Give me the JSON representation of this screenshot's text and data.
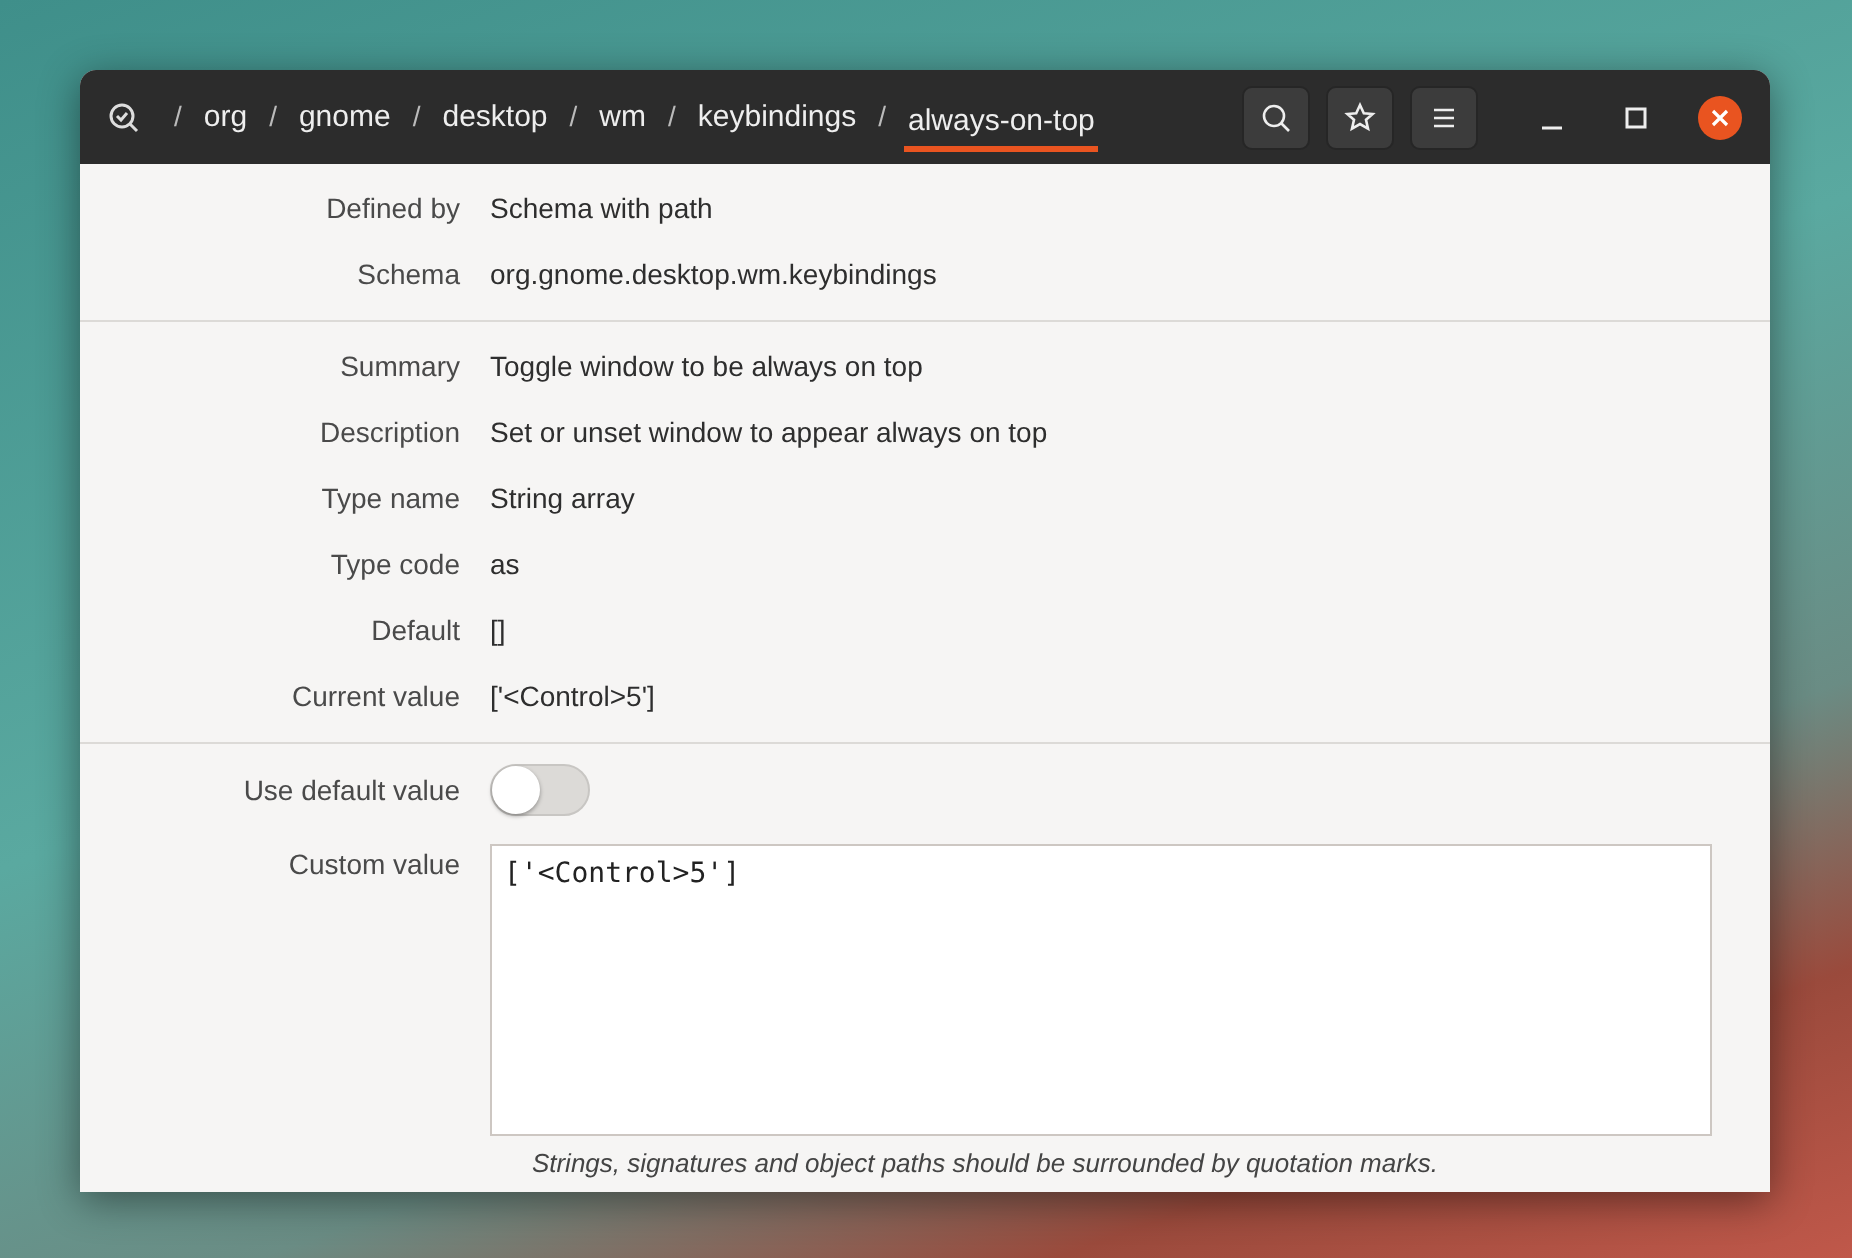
{
  "header": {
    "breadcrumb": [
      {
        "label": "org",
        "selected": false
      },
      {
        "label": "gnome",
        "selected": false
      },
      {
        "label": "desktop",
        "selected": false
      },
      {
        "label": "wm",
        "selected": false
      },
      {
        "label": "keybindings",
        "selected": false
      },
      {
        "label": "always-on-top",
        "selected": true
      }
    ],
    "separator": "/"
  },
  "sections": [
    {
      "rows": [
        {
          "label": "Defined by",
          "value": "Schema with path"
        },
        {
          "label": "Schema",
          "value": "org.gnome.desktop.wm.keybindings"
        }
      ]
    },
    {
      "rows": [
        {
          "label": "Summary",
          "value": "Toggle window to be always on top"
        },
        {
          "label": "Description",
          "value": "Set or unset window to appear always on top"
        },
        {
          "label": "Type name",
          "value": "String array"
        },
        {
          "label": "Type code",
          "value": "as"
        },
        {
          "label": "Default",
          "value": "[]"
        },
        {
          "label": "Current value",
          "value": "['<Control>5']"
        }
      ]
    }
  ],
  "use_default": {
    "label": "Use default value",
    "on": false
  },
  "custom_value": {
    "label": "Custom value",
    "value": "['<Control>5']"
  },
  "hint": "Strings, signatures and object paths should be surrounded by quotation marks."
}
